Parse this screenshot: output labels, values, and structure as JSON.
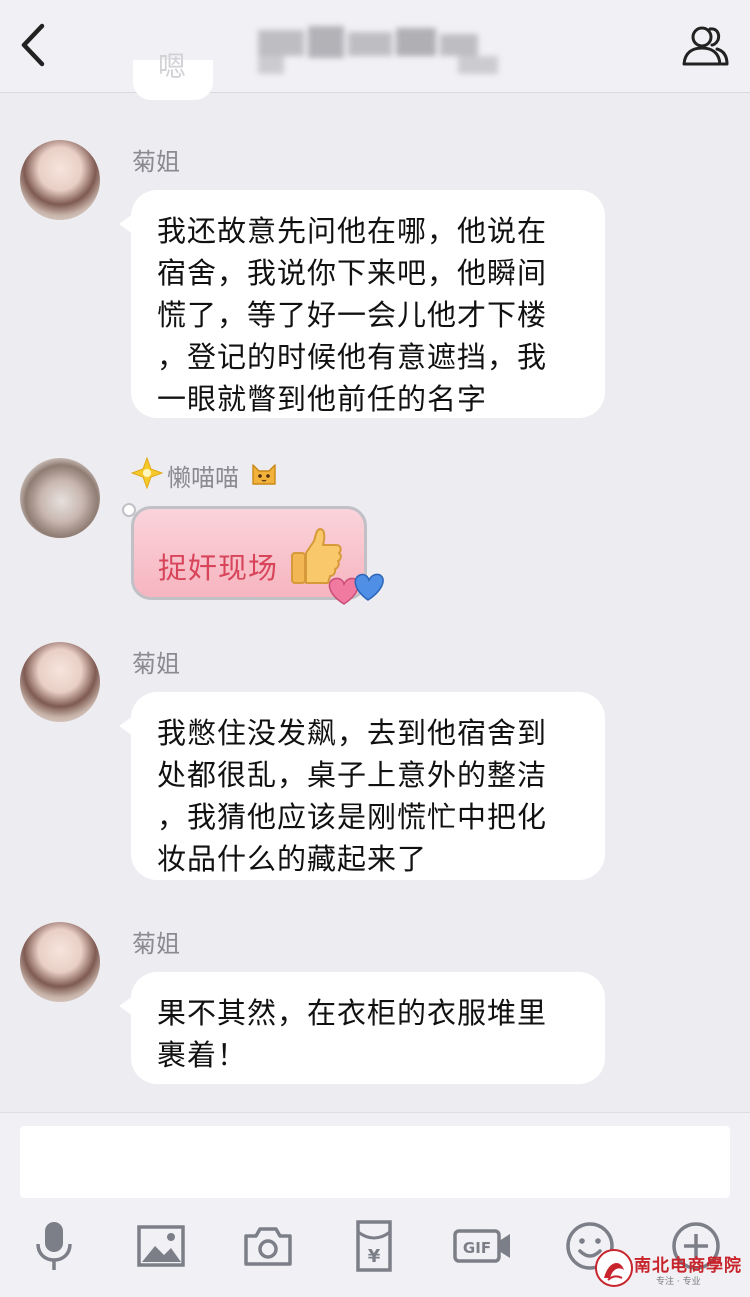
{
  "header": {
    "title": "",
    "back_icon": "chevron-left-icon",
    "members_icon": "people-icon"
  },
  "previous_message": {
    "text": "嗯"
  },
  "messages": [
    {
      "sender": "菊姐",
      "avatar": "avatar-juji",
      "lines": [
        "我还故意先问他在哪，他说在",
        "宿舍，我说你下来吧，他瞬间",
        "慌了，等了好一会儿他才下楼",
        "，登记的时候他有意遮挡，我",
        "一眼就瞥到他前任的名字"
      ]
    },
    {
      "sender": "懒喵喵",
      "avatar": "avatar-lanmiaomiao",
      "sticker_text": "捉奸现场",
      "badge_icon": "star-badge-icon",
      "emoji_icon": "cat-face-icon",
      "sticker_icons": [
        "thumbs-up-icon",
        "hearts-icon"
      ]
    },
    {
      "sender": "菊姐",
      "avatar": "avatar-juji",
      "lines": [
        "我憋住没发飙，去到他宿舍到",
        "处都很乱，桌子上意外的整洁",
        "，我猜他应该是刚慌忙中把化",
        "妆品什么的藏起来了"
      ]
    },
    {
      "sender": "菊姐",
      "avatar": "avatar-juji",
      "lines": [
        "果不其然，在衣柜的衣服堆里",
        "裹着！"
      ]
    }
  ],
  "input": {
    "value": "",
    "placeholder": ""
  },
  "toolbar": [
    "microphone-icon",
    "image-icon",
    "camera-icon",
    "red-packet-icon",
    "gif-icon",
    "emoji-icon",
    "plus-icon"
  ],
  "watermark": {
    "title": "南北电商學院",
    "subtitle": "专注 · 专业"
  },
  "colors": {
    "background": "#ececf1",
    "bubble": "#ffffff",
    "sticker": "#f6b5c0",
    "sticker_text": "#d8455b",
    "watermark": "#c8242b"
  }
}
